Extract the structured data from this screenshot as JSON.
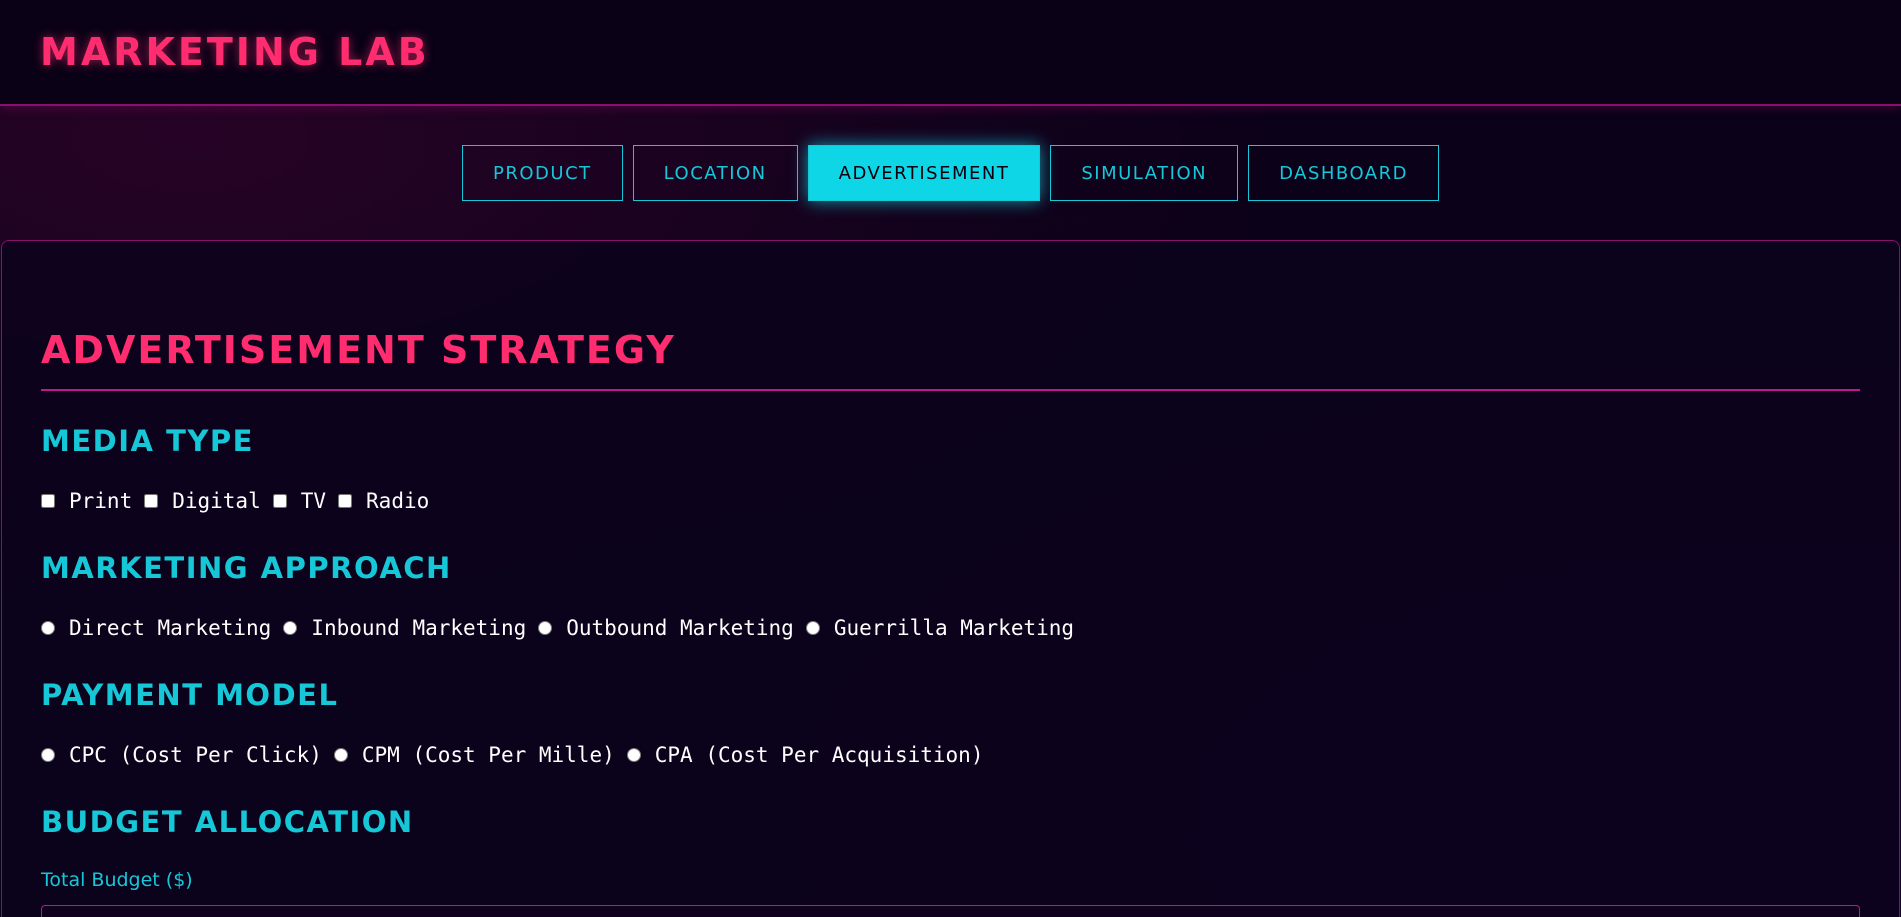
{
  "app": {
    "title": "MARKETING LAB"
  },
  "nav": {
    "tabs": [
      {
        "label": "PRODUCT"
      },
      {
        "label": "LOCATION"
      },
      {
        "label": "ADVERTISEMENT",
        "active": true
      },
      {
        "label": "SIMULATION"
      },
      {
        "label": "DASHBOARD"
      }
    ]
  },
  "section": {
    "title": "ADVERTISEMENT STRATEGY"
  },
  "media_type": {
    "heading": "MEDIA TYPE",
    "options": [
      {
        "label": "Print",
        "checked": false
      },
      {
        "label": "Digital",
        "checked": false
      },
      {
        "label": "TV",
        "checked": false
      },
      {
        "label": "Radio",
        "checked": false
      }
    ]
  },
  "approach": {
    "heading": "MARKETING APPROACH",
    "options": [
      {
        "label": "Direct Marketing",
        "selected": false
      },
      {
        "label": "Inbound Marketing",
        "selected": false
      },
      {
        "label": "Outbound Marketing",
        "selected": false
      },
      {
        "label": "Guerrilla Marketing",
        "selected": false
      }
    ]
  },
  "payment": {
    "heading": "PAYMENT MODEL",
    "options": [
      {
        "label": "CPC (Cost Per Click)",
        "selected": false
      },
      {
        "label": "CPM (Cost Per Mille)",
        "selected": false
      },
      {
        "label": "CPA (Cost Per Acquisition)",
        "selected": false
      }
    ]
  },
  "budget": {
    "heading": "BUDGET ALLOCATION",
    "total_label": "Total Budget ($)",
    "total_value": ""
  },
  "colors": {
    "accent_pink": "#ff2d6f",
    "accent_cyan": "#16c7d8",
    "background": "#0b0118",
    "border_magenta": "#c0168f"
  }
}
